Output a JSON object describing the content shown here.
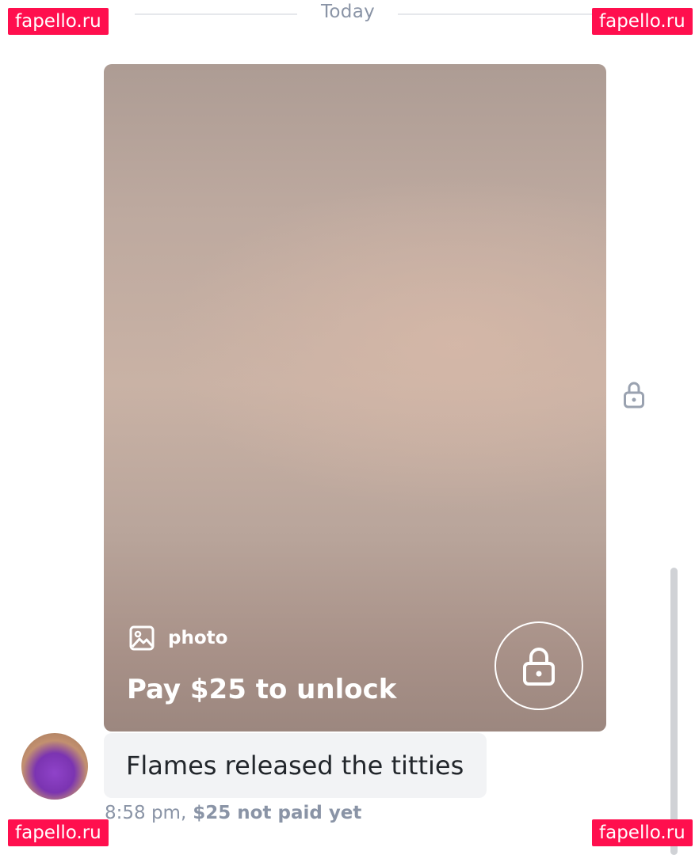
{
  "chat": {
    "date_divider": "Today",
    "message": {
      "media_type_label": "photo",
      "unlock_text": "Pay $25 to unlock",
      "text": "Flames released the titties",
      "time": "8:58 pm,",
      "payment_status": "$25 not paid yet"
    }
  },
  "watermarks": {
    "top_left": "fapello.ru",
    "top_right": "fapello.ru",
    "bottom_left": "fapello.ru",
    "bottom_right": "fapello.ru"
  },
  "icons": {
    "photo": "image-icon",
    "lock_button": "lock-icon",
    "side_lock": "lock-icon"
  },
  "colors": {
    "watermark_bg": "#ff0f4e",
    "bubble_bg": "#f2f3f5",
    "meta_text": "#8a94a6",
    "media_placeholder": "#bca89e"
  }
}
